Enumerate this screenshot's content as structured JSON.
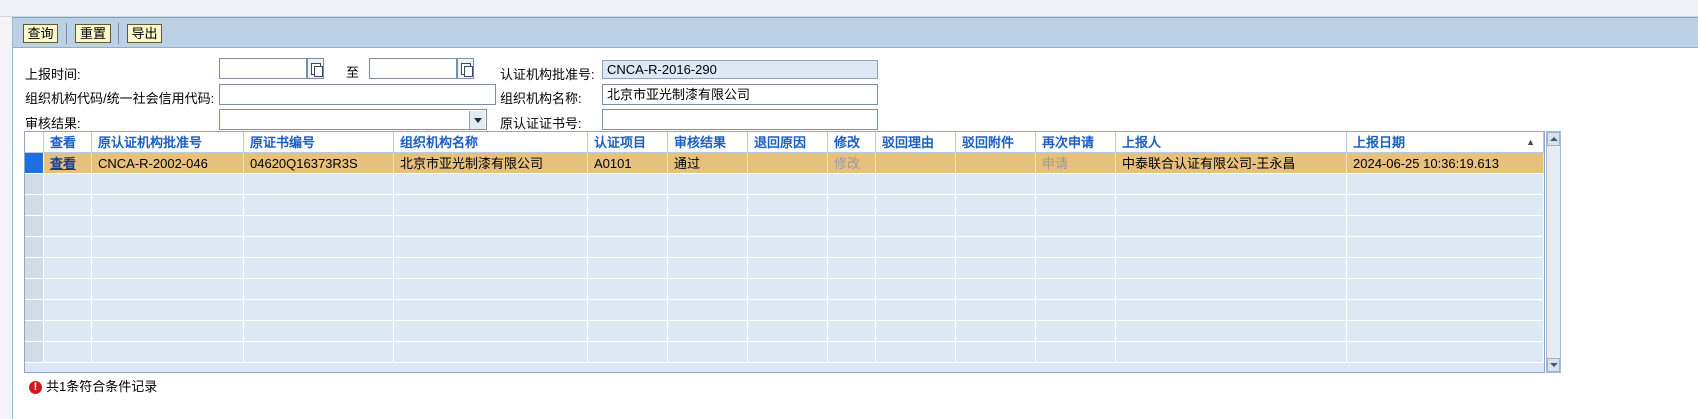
{
  "toolbar": {
    "query_label": "查询",
    "reset_label": "重置",
    "export_label": "导出"
  },
  "form": {
    "report_time_label": "上报时间:",
    "report_time_from": "",
    "report_time_to": "",
    "to_label": "至",
    "approval_no_label": "认证机构批准号:",
    "approval_no_value": "CNCA-R-2016-290",
    "org_code_label": "组织机构代码/统一社会信用代码:",
    "org_code_value": "",
    "org_name_label": "组织机构名称:",
    "org_name_value": "北京市亚光制漆有限公司",
    "audit_result_label": "审核结果:",
    "audit_result_value": "",
    "orig_cert_label": "原认证证书号:",
    "orig_cert_value": ""
  },
  "grid": {
    "columns": [
      "查看",
      "原认证机构批准号",
      "原证书编号",
      "组织机构名称",
      "认证项目",
      "审核结果",
      "退回原因",
      "修改",
      "驳回理由",
      "驳回附件",
      "再次申请",
      "上报人",
      "上报日期"
    ],
    "sort_indicator": "▲",
    "rows": [
      {
        "view": "查看",
        "orig_approval_no": "CNCA-R-2002-046",
        "orig_cert_no": "04620Q16373R3S",
        "org_name": "北京市亚光制漆有限公司",
        "cert_item": "A0101",
        "audit_result": "通过",
        "return_reason": "",
        "modify": "修改",
        "reject_reason": "",
        "reject_attachment": "",
        "reapply": "申请",
        "reporter": "中泰联合认证有限公司-王永昌",
        "report_date": "2024-06-25 10:36:19.613"
      }
    ]
  },
  "status": {
    "icon": "error-icon",
    "text": "共1条符合条件记录"
  },
  "colors": {
    "toolbar_bg": "#bcd1e6",
    "selected_row": "#e6c07d",
    "header_text": "#1b5fc1",
    "grid_bg": "#dce9f5"
  }
}
